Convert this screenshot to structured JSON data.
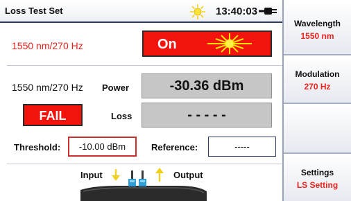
{
  "window": {
    "title": "Loss Test Set",
    "time": "13:40:03"
  },
  "source": {
    "wavelength_freq": "1550 nm/270 Hz",
    "state_label": "On"
  },
  "meter": {
    "wavelength_freq": "1550 nm/270 Hz",
    "power_label": "Power",
    "power_value": "-30.36 dBm",
    "status": "FAIL",
    "loss_label": "Loss",
    "loss_value": "- - - - -",
    "threshold_label": "Threshold:",
    "threshold_value": "-10.00 dBm",
    "reference_label": "Reference:",
    "reference_value": "-----"
  },
  "ports": {
    "input_label": "Input",
    "output_label": "Output"
  },
  "sidebar": {
    "items": [
      {
        "title": "Wavelength",
        "value": "1550 nm"
      },
      {
        "title": "Modulation",
        "value": "270 Hz"
      },
      {
        "title": "",
        "value": ""
      },
      {
        "title": "Settings",
        "value": "LS Setting"
      }
    ]
  },
  "colors": {
    "accent_red": "#f2140c",
    "label_red": "#e8231c",
    "sidebar_bg": "#c2c9da",
    "navy": "#2a3a68"
  },
  "icons": [
    "sun-icon",
    "battery-plug-icon",
    "laser-icon",
    "arrow-down-icon",
    "arrow-up-icon",
    "device-image"
  ]
}
